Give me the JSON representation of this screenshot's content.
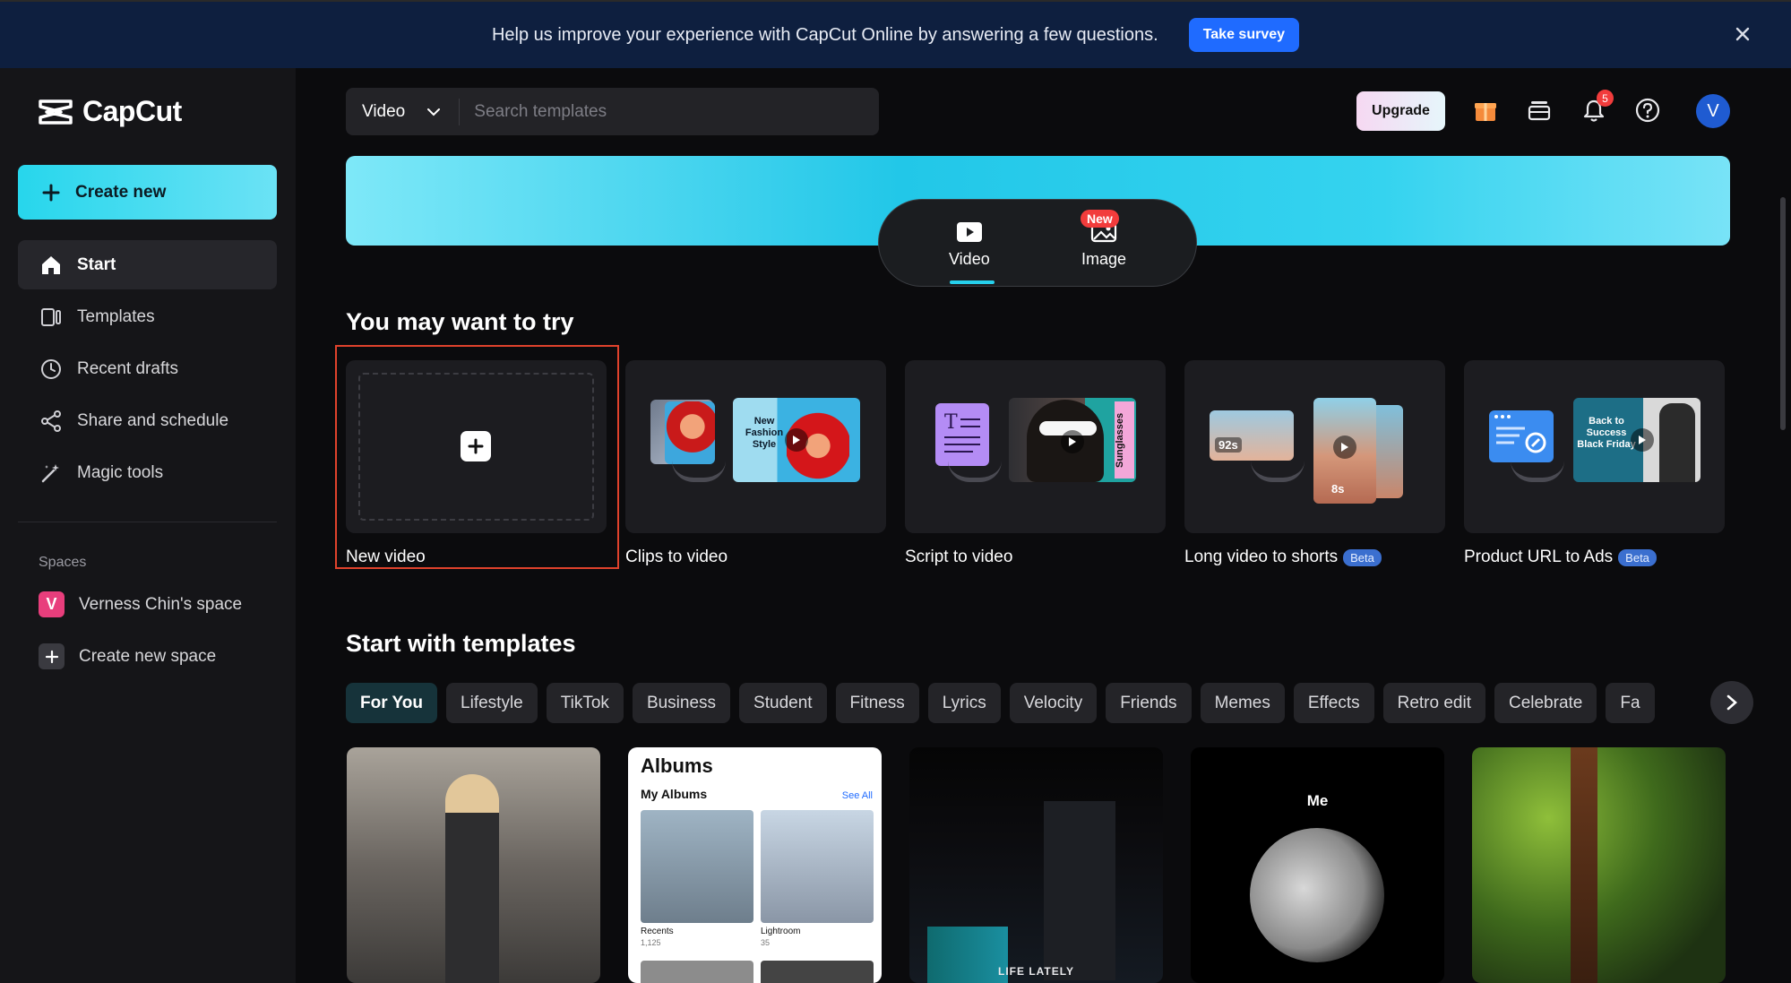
{
  "banner": {
    "text": "Help us improve your experience with CapCut Online by answering a few questions.",
    "survey_label": "Take survey"
  },
  "sidebar": {
    "brand": "CapCut",
    "create_label": "Create new",
    "nav": [
      {
        "label": "Start",
        "icon": "home-icon"
      },
      {
        "label": "Templates",
        "icon": "templates-icon"
      },
      {
        "label": "Recent drafts",
        "icon": "clock-icon"
      },
      {
        "label": "Share and schedule",
        "icon": "share-icon"
      },
      {
        "label": "Magic tools",
        "icon": "magic-wand-icon"
      }
    ],
    "spaces_label": "Spaces",
    "space_name": "Verness Chin's space",
    "space_initial": "V",
    "create_space_label": "Create new space"
  },
  "topbar": {
    "search_type": "Video",
    "search_placeholder": "Search templates",
    "upgrade_label": "Upgrade",
    "notification_count": "5",
    "user_initial": "V"
  },
  "modes": {
    "video_label": "Video",
    "image_label": "Image",
    "new_badge": "New"
  },
  "try_section": {
    "title": "You may want to try",
    "cards": [
      {
        "label": "New video",
        "badge": ""
      },
      {
        "label": "Clips to video",
        "badge": ""
      },
      {
        "label": "Script to video",
        "badge": ""
      },
      {
        "label": "Long video to shorts",
        "badge": "Beta"
      },
      {
        "label": "Product URL to Ads",
        "badge": "Beta"
      }
    ],
    "clips_overlay": "New Fashion Style",
    "script_overlay": "Sunglasses",
    "shorts_duration_a": "92s",
    "shorts_duration_b": "8s",
    "ads_overlay": "Back to Success Black Friday"
  },
  "templates_section": {
    "title": "Start with templates",
    "chips": [
      "For You",
      "Lifestyle",
      "TikTok",
      "Business",
      "Student",
      "Fitness",
      "Lyrics",
      "Velocity",
      "Friends",
      "Memes",
      "Effects",
      "Retro edit",
      "Celebrate",
      "Fa"
    ],
    "albums_title": "Albums",
    "albums_sub": "My Albums",
    "albums_see_all": "See All",
    "albums_recents": "Recents",
    "albums_recents_count": "1,125",
    "albums_lightroom": "Lightroom",
    "albums_lightroom_count": "35",
    "moon_caption": "Me",
    "night_caption": "LIFE LATELY"
  },
  "colors": {
    "accent": "#26d0ec",
    "banner_bg": "#0e1f3f",
    "survey_btn": "#1f6bff",
    "selection_outline": "#e0422c",
    "beta_badge": "#3b6fcf"
  }
}
